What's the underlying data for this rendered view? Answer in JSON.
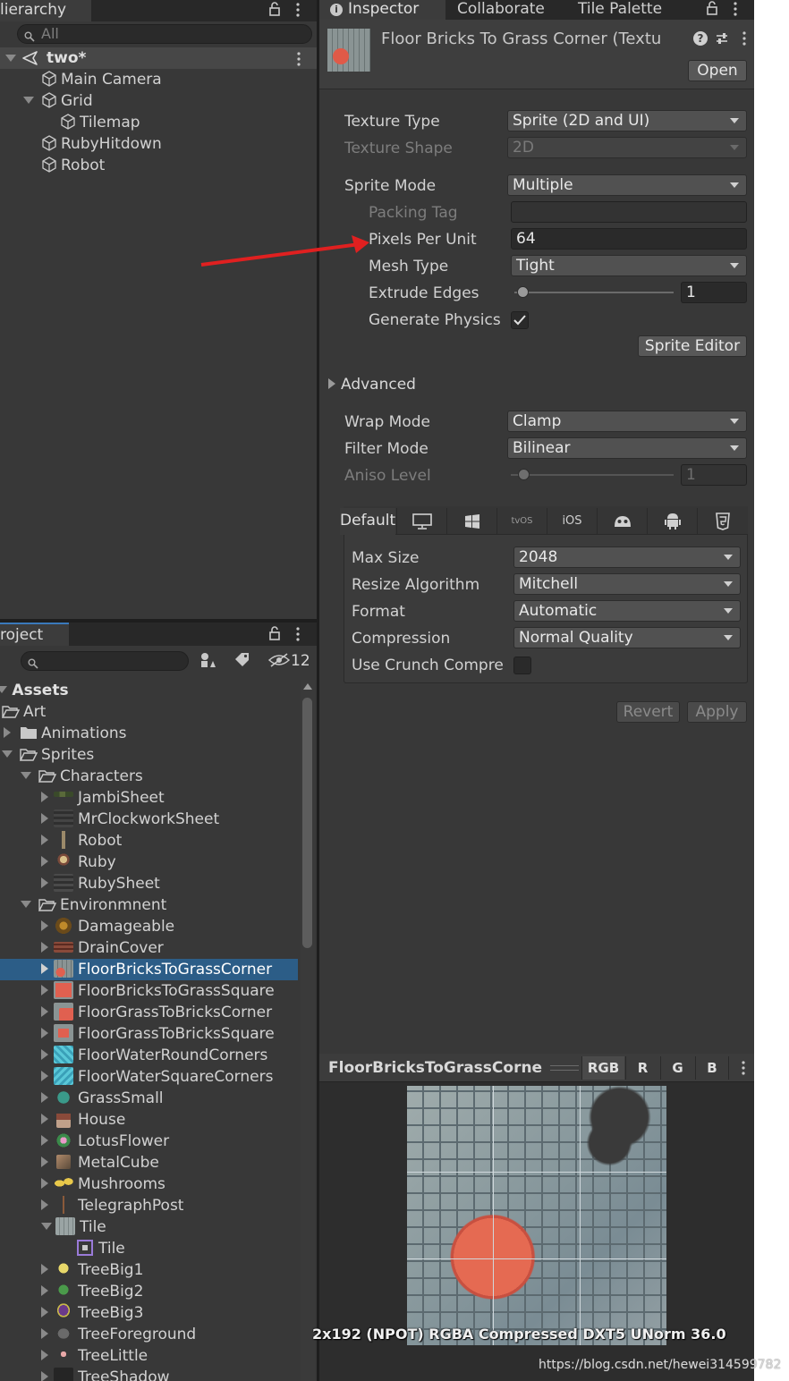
{
  "hierarchy": {
    "tab_label": "lierarchy",
    "search_placeholder": "All",
    "scene": "two*",
    "items": [
      {
        "label": "Main Camera"
      },
      {
        "label": "Grid"
      },
      {
        "label": "Tilemap"
      },
      {
        "label": "RubyHitdown"
      },
      {
        "label": "Robot"
      }
    ]
  },
  "project": {
    "tab_label": "roject",
    "hidden_count": "12",
    "tree": [
      {
        "label": "Assets"
      },
      {
        "label": "Art"
      },
      {
        "label": "Animations"
      },
      {
        "label": "Sprites"
      },
      {
        "label": "Characters"
      },
      {
        "label": "JambiSheet"
      },
      {
        "label": "MrClockworkSheet"
      },
      {
        "label": "Robot"
      },
      {
        "label": "Ruby"
      },
      {
        "label": "RubySheet"
      },
      {
        "label": "Environmnent"
      },
      {
        "label": "Damageable"
      },
      {
        "label": "DrainCover"
      },
      {
        "label": "FloorBricksToGrassCorner"
      },
      {
        "label": "FloorBricksToGrassSquare"
      },
      {
        "label": "FloorGrassToBricksCorner"
      },
      {
        "label": "FloorGrassToBricksSquare"
      },
      {
        "label": "FloorWaterRoundCorners"
      },
      {
        "label": "FloorWaterSquareCorners"
      },
      {
        "label": "GrassSmall"
      },
      {
        "label": "House"
      },
      {
        "label": "LotusFlower"
      },
      {
        "label": "MetalCube"
      },
      {
        "label": "Mushrooms"
      },
      {
        "label": "TelegraphPost"
      },
      {
        "label": "Tile"
      },
      {
        "label": "Tile"
      },
      {
        "label": "TreeBig1"
      },
      {
        "label": "TreeBig2"
      },
      {
        "label": "TreeBig3"
      },
      {
        "label": "TreeForeground"
      },
      {
        "label": "TreeLittle"
      },
      {
        "label": "TreeShadow"
      }
    ]
  },
  "inspector": {
    "tabs": [
      "Inspector",
      "Collaborate",
      "Tile Palette"
    ],
    "asset_title": "Floor Bricks To Grass Corner (Textu",
    "open_label": "Open",
    "texture_type": {
      "label": "Texture Type",
      "value": "Sprite (2D and UI)"
    },
    "texture_shape": {
      "label": "Texture Shape",
      "value": "2D"
    },
    "sprite_mode": {
      "label": "Sprite Mode",
      "value": "Multiple"
    },
    "packing_tag": {
      "label": "Packing Tag",
      "value": ""
    },
    "pixels_per_unit": {
      "label": "Pixels Per Unit",
      "value": "64"
    },
    "mesh_type": {
      "label": "Mesh Type",
      "value": "Tight"
    },
    "extrude_edges": {
      "label": "Extrude Edges",
      "value": "1",
      "slider_fraction": 0.04
    },
    "generate_physics": {
      "label": "Generate Physics",
      "checked": true
    },
    "sprite_editor_label": "Sprite Editor",
    "advanced_label": "Advanced",
    "wrap_mode": {
      "label": "Wrap Mode",
      "value": "Clamp"
    },
    "filter_mode": {
      "label": "Filter Mode",
      "value": "Bilinear"
    },
    "aniso_level": {
      "label": "Aniso Level",
      "value": "1",
      "slider_fraction": 0.05
    },
    "platform_tabs": [
      "Default",
      "desktop-icon",
      "windows-icon",
      "tvOS",
      "iOS",
      "webgl-icon",
      "android-icon",
      "html5-icon"
    ],
    "max_size": {
      "label": "Max Size",
      "value": "2048"
    },
    "resize_algorithm": {
      "label": "Resize Algorithm",
      "value": "Mitchell"
    },
    "format": {
      "label": "Format",
      "value": "Automatic"
    },
    "compression": {
      "label": "Compression",
      "value": "Normal Quality"
    },
    "use_crunch": {
      "label": "Use Crunch Compre",
      "checked": false
    },
    "revert_label": "Revert",
    "apply_label": "Apply"
  },
  "preview": {
    "title": "FloorBricksToGrassCornei",
    "channels": [
      "RGB",
      "R",
      "G",
      "B"
    ],
    "info": "2x192 (NPOT)  RGBA Compressed DXT5 UNorm   36.0"
  },
  "watermark": "https://blog.csdn.net/hewei314599782",
  "colors": {
    "panel": "#383838",
    "tabbar": "#282828",
    "selection": "#2c5d87",
    "annotation_arrow": "#e02020"
  }
}
